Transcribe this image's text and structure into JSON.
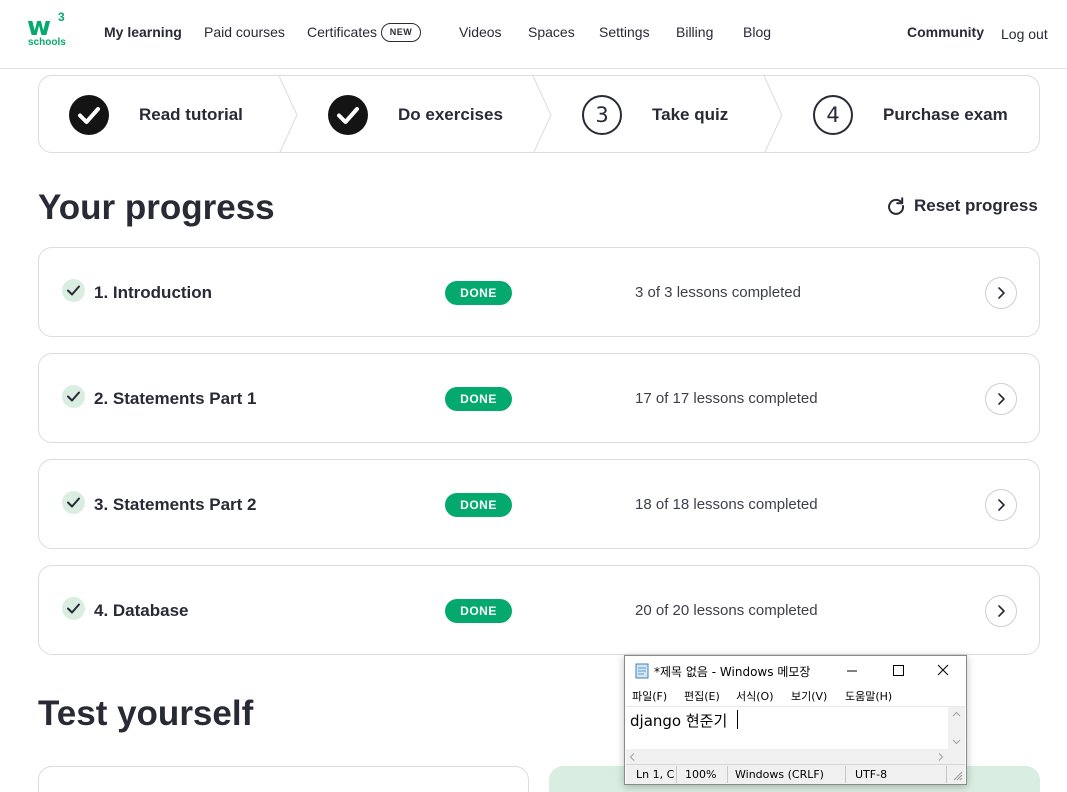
{
  "logo": {
    "mark": "w",
    "sup": "3",
    "sub": "schools"
  },
  "nav": {
    "my_learning": "My learning",
    "paid_courses": "Paid courses",
    "certificates": "Certificates",
    "new_badge": "NEW",
    "videos": "Videos",
    "spaces": "Spaces",
    "settings": "Settings",
    "billing": "Billing",
    "blog": "Blog",
    "community": "Community",
    "logout": "Log out"
  },
  "steps": [
    {
      "label": "Read tutorial",
      "state": "done"
    },
    {
      "label": "Do exercises",
      "state": "done"
    },
    {
      "label": "Take quiz",
      "number": "3",
      "state": "todo"
    },
    {
      "label": "Purchase exam",
      "number": "4",
      "state": "todo"
    }
  ],
  "progress": {
    "heading": "Your progress",
    "reset_label": "Reset progress",
    "items": [
      {
        "title": "1. Introduction",
        "status": "DONE",
        "count": "3 of 3 lessons completed"
      },
      {
        "title": "2. Statements Part 1",
        "status": "DONE",
        "count": "17 of 17 lessons completed"
      },
      {
        "title": "3. Statements Part 2",
        "status": "DONE",
        "count": "18 of 18 lessons completed"
      },
      {
        "title": "4. Database",
        "status": "DONE",
        "count": "20 of 20 lessons completed"
      }
    ]
  },
  "test": {
    "heading": "Test yourself"
  },
  "notepad": {
    "title": "*제목 없음 - Windows 메모장",
    "menus": [
      "파일(F)",
      "편집(E)",
      "서식(O)",
      "보기(V)",
      "도움말(H)"
    ],
    "content": "django 현준기",
    "status": {
      "position": "Ln 1, C",
      "zoom": "100%",
      "line_ending": "Windows (CRLF)",
      "encoding": "UTF-8"
    }
  },
  "colors": {
    "accent": "#04aa6d",
    "check_bg": "#d9eee1",
    "text": "#282a35"
  }
}
